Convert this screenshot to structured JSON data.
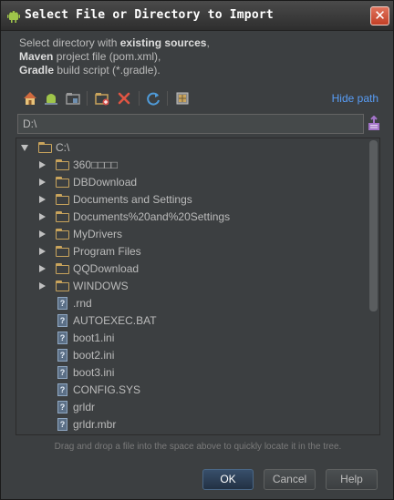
{
  "window": {
    "title": "Select File or Directory to Import",
    "close_glyph": "✕"
  },
  "description": {
    "line1_prefix": "Select directory with ",
    "line1_bold": "existing sources",
    "line1_suffix": ",",
    "line2_bold": "Maven",
    "line2_suffix": " project file (pom.xml),",
    "line3_bold": "Gradle",
    "line3_suffix": " build script (*.gradle)."
  },
  "toolbar": {
    "icons": [
      "home-icon",
      "android-project-icon",
      "module-folder-icon",
      "new-folder-icon",
      "delete-icon",
      "refresh-icon",
      "show-hidden-icon"
    ],
    "hide_path_label": "Hide path"
  },
  "path": {
    "value": "D:\\"
  },
  "tree": {
    "root": {
      "label": "C:\\",
      "expanded": true
    },
    "items": [
      {
        "label": "360□□□□",
        "type": "folder"
      },
      {
        "label": "DBDownload",
        "type": "folder"
      },
      {
        "label": "Documents and Settings",
        "type": "folder"
      },
      {
        "label": "Documents%20and%20Settings",
        "type": "folder"
      },
      {
        "label": "MyDrivers",
        "type": "folder"
      },
      {
        "label": "Program Files",
        "type": "folder"
      },
      {
        "label": "QQDownload",
        "type": "folder"
      },
      {
        "label": "WINDOWS",
        "type": "folder"
      },
      {
        "label": ".rnd",
        "type": "file"
      },
      {
        "label": "AUTOEXEC.BAT",
        "type": "file"
      },
      {
        "label": "boot1.ini",
        "type": "file"
      },
      {
        "label": "boot2.ini",
        "type": "file"
      },
      {
        "label": "boot3.ini",
        "type": "file"
      },
      {
        "label": "CONFIG.SYS",
        "type": "file"
      },
      {
        "label": "grldr",
        "type": "file"
      },
      {
        "label": "grldr.mbr",
        "type": "file"
      }
    ],
    "file_glyph": "?"
  },
  "hint": "Drag and drop a file into the space above to quickly locate it in the tree.",
  "buttons": {
    "ok": "OK",
    "cancel": "Cancel",
    "help": "Help"
  },
  "colors": {
    "background": "#3c3f41",
    "link": "#589df6",
    "folder": "#c9a45c",
    "primary_button": "#2f4660"
  }
}
